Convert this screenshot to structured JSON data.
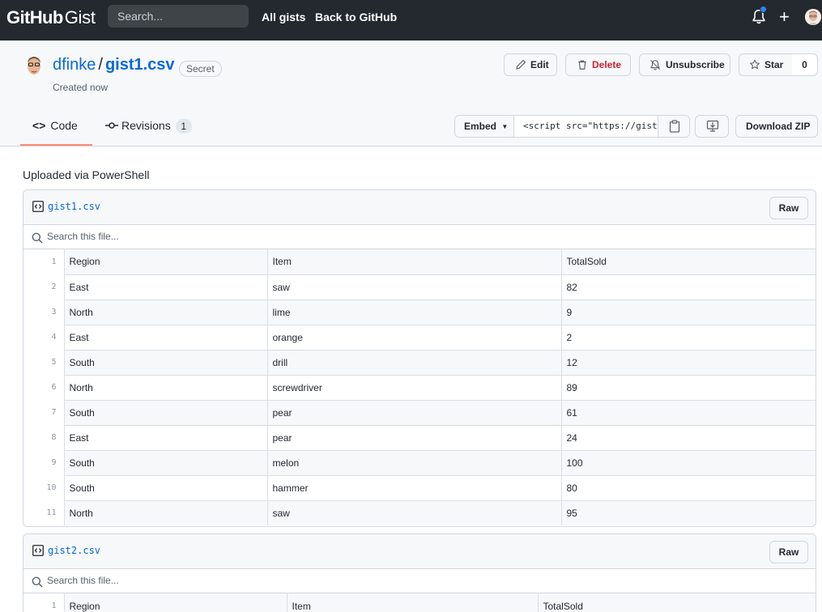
{
  "header": {
    "brand_bold": "GitHub",
    "brand_light": "Gist",
    "search_placeholder": "Search...",
    "nav": [
      "All gists",
      "Back to GitHub"
    ]
  },
  "gist": {
    "owner": "dfinke",
    "name": "gist1.csv",
    "separator": "/",
    "visibility": "Secret",
    "created": "Created now",
    "description": "Uploaded via PowerShell"
  },
  "actions": {
    "edit": "Edit",
    "delete": "Delete",
    "unsubscribe": "Unsubscribe",
    "star": "Star",
    "star_count": "0",
    "embed": "Embed",
    "embed_value": "<script src=\"https://gist.github.com/dfinke/",
    "download": "Download ZIP"
  },
  "tabs": {
    "code": "Code",
    "revisions": "Revisions",
    "revisions_count": "1"
  },
  "files": [
    {
      "name": "gist1.csv",
      "raw": "Raw",
      "search_placeholder": "Search this file...",
      "rows": [
        [
          "1",
          "Region",
          "Item",
          "TotalSold"
        ],
        [
          "2",
          "East",
          "saw",
          "82"
        ],
        [
          "3",
          "North",
          "lime",
          "9"
        ],
        [
          "4",
          "East",
          "orange",
          "2"
        ],
        [
          "5",
          "South",
          "drill",
          "12"
        ],
        [
          "6",
          "North",
          "screwdriver",
          "89"
        ],
        [
          "7",
          "South",
          "pear",
          "61"
        ],
        [
          "8",
          "East",
          "pear",
          "24"
        ],
        [
          "9",
          "South",
          "melon",
          "100"
        ],
        [
          "10",
          "South",
          "hammer",
          "80"
        ],
        [
          "11",
          "North",
          "saw",
          "95"
        ]
      ]
    },
    {
      "name": "gist2.csv",
      "raw": "Raw",
      "search_placeholder": "Search this file...",
      "rows": [
        [
          "1",
          "Region",
          "Item",
          "TotalSold"
        ]
      ]
    }
  ],
  "colors": {
    "header_bg": "#24292f",
    "link": "#0969da",
    "danger": "#cf222e",
    "tab_underline": "#fd8c73",
    "notification_dot": "#2f81f7"
  }
}
